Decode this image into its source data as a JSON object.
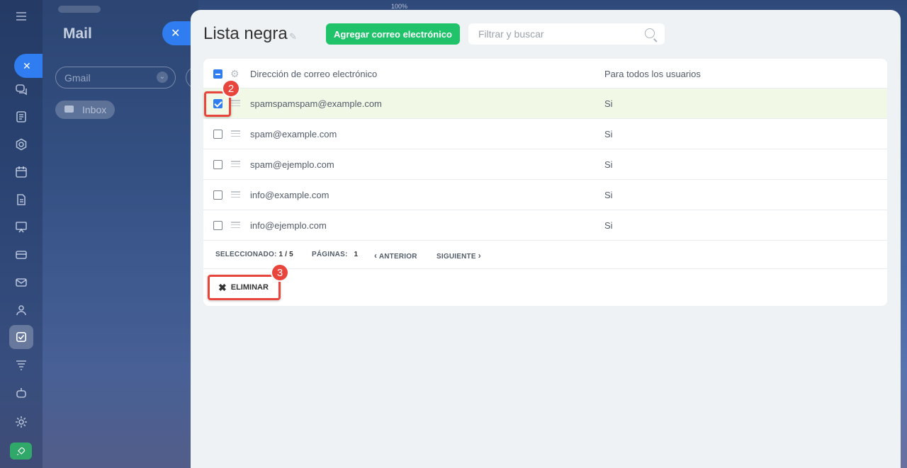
{
  "background": {
    "zoom_label": "100%"
  },
  "mail_panel": {
    "title": "Mail",
    "account_select": "Gmail",
    "inbox_label": "Inbox"
  },
  "blacklist": {
    "title": "Lista negra",
    "add_button": "Agregar correo electrónico",
    "search_placeholder": "Filtrar y buscar",
    "columns": {
      "email": "Dirección de correo electrónico",
      "all_users": "Para todos los usuarios"
    },
    "rows": [
      {
        "email": "spamspamspam@example.com",
        "all_users": "Si",
        "checked": true
      },
      {
        "email": "spam@example.com",
        "all_users": "Si",
        "checked": false
      },
      {
        "email": "spam@ejemplo.com",
        "all_users": "Si",
        "checked": false
      },
      {
        "email": "info@example.com",
        "all_users": "Si",
        "checked": false
      },
      {
        "email": "info@ejemplo.com",
        "all_users": "Si",
        "checked": false
      }
    ],
    "footer": {
      "selected_label": "SELECCIONADO:",
      "selected_value": "1 / 5",
      "pages_label": "PÁGINAS:",
      "pages_value": "1",
      "prev": "ANTERIOR",
      "next": "SIGUIENTE"
    },
    "delete_button": "ELIMINAR"
  },
  "annotations": {
    "step_checkbox": "2",
    "step_delete": "3"
  },
  "colors": {
    "accent_blue": "#2f7df0",
    "add_green": "#20c26a",
    "annotation_red": "#e8453c",
    "selected_row": "#f1f8e6"
  }
}
